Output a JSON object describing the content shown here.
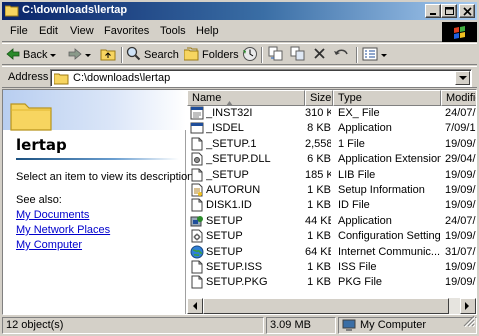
{
  "window": {
    "title": "C:\\downloads\\lertap",
    "icon": "folder-icon"
  },
  "menu": [
    {
      "label": "File",
      "key": "F"
    },
    {
      "label": "Edit",
      "key": "E"
    },
    {
      "label": "View",
      "key": "V"
    },
    {
      "label": "Favorites",
      "key": "a"
    },
    {
      "label": "Tools",
      "key": "T"
    },
    {
      "label": "Help",
      "key": "H"
    }
  ],
  "toolbar": {
    "back_label": "Back",
    "search_label": "Search",
    "folders_label": "Folders"
  },
  "address": {
    "label": "Address",
    "value": "C:\\downloads\\lertap"
  },
  "left_pane": {
    "title": "lertap",
    "hint": "Select an item to view its description.",
    "see_also": "See also:",
    "links": [
      "My Documents",
      "My Network Places",
      "My Computer"
    ]
  },
  "columns": {
    "name": "Name",
    "size": "Size",
    "type": "Type",
    "modified": "Modifie"
  },
  "files": [
    {
      "name": "_INST32I",
      "size": "310 KB",
      "type": "EX_ File",
      "modified": "24/07/",
      "icon": "ex-file-icon"
    },
    {
      "name": "_ISDEL",
      "size": "8 KB",
      "type": "Application",
      "modified": "7/09/1",
      "icon": "application-icon"
    },
    {
      "name": "_SETUP.1",
      "size": "2,558 KB",
      "type": "1 File",
      "modified": "19/09/",
      "icon": "file-icon"
    },
    {
      "name": "_SETUP.DLL",
      "size": "6 KB",
      "type": "Application Extension",
      "modified": "29/04/",
      "icon": "dll-icon"
    },
    {
      "name": "_SETUP",
      "size": "185 KB",
      "type": "LIB File",
      "modified": "19/09/",
      "icon": "file-icon"
    },
    {
      "name": "AUTORUN",
      "size": "1 KB",
      "type": "Setup Information",
      "modified": "19/09/",
      "icon": "setup-info-icon"
    },
    {
      "name": "DISK1.ID",
      "size": "1 KB",
      "type": "ID File",
      "modified": "19/09/",
      "icon": "file-icon"
    },
    {
      "name": "SETUP",
      "size": "44 KB",
      "type": "Application",
      "modified": "24/07/",
      "icon": "setup-app-icon"
    },
    {
      "name": "SETUP",
      "size": "1 KB",
      "type": "Configuration Settings",
      "modified": "19/09/",
      "icon": "config-icon"
    },
    {
      "name": "SETUP",
      "size": "64 KB",
      "type": "Internet Communic...",
      "modified": "31/07/",
      "icon": "internet-icon"
    },
    {
      "name": "SETUP.ISS",
      "size": "1 KB",
      "type": "ISS File",
      "modified": "19/09/",
      "icon": "file-icon"
    },
    {
      "name": "SETUP.PKG",
      "size": "1 KB",
      "type": "PKG File",
      "modified": "19/09/",
      "icon": "file-icon"
    }
  ],
  "status": {
    "count": "12 object(s)",
    "size": "3.09 MB",
    "zone": "My Computer"
  }
}
